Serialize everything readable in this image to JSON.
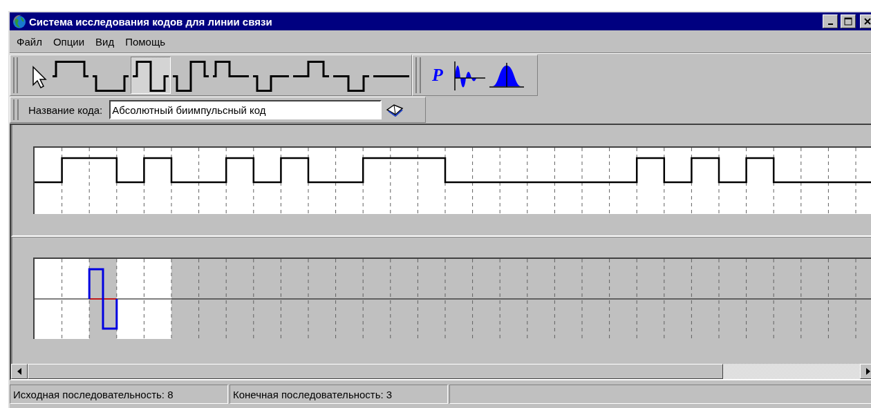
{
  "window": {
    "title": "Система исследования кодов для линии связи"
  },
  "menu": [
    "Файл",
    "Опции",
    "Вид",
    "Помощь"
  ],
  "code_toolbar": [
    {
      "kind": "pointer",
      "selected": false
    },
    {
      "kind": "pulse-high",
      "selected": false
    },
    {
      "kind": "pulse-low",
      "selected": false
    },
    {
      "kind": "biphase-up-down",
      "selected": true
    },
    {
      "kind": "biphase-down-up",
      "selected": false
    },
    {
      "kind": "half-high-early",
      "selected": false
    },
    {
      "kind": "half-low-early",
      "selected": false
    },
    {
      "kind": "half-high-late",
      "selected": false
    },
    {
      "kind": "half-low-late",
      "selected": false
    },
    {
      "kind": "zero",
      "selected": false
    }
  ],
  "analysis_toolbar": [
    {
      "kind": "letter",
      "label": "P"
    },
    {
      "kind": "wave"
    },
    {
      "kind": "bell"
    }
  ],
  "code_name": {
    "label": "Название кода:",
    "value": "Абсолютный биимпульсный код"
  },
  "status_bar": [
    "Исходная последовательность: 8",
    "Конечная последовательность: 3"
  ]
}
